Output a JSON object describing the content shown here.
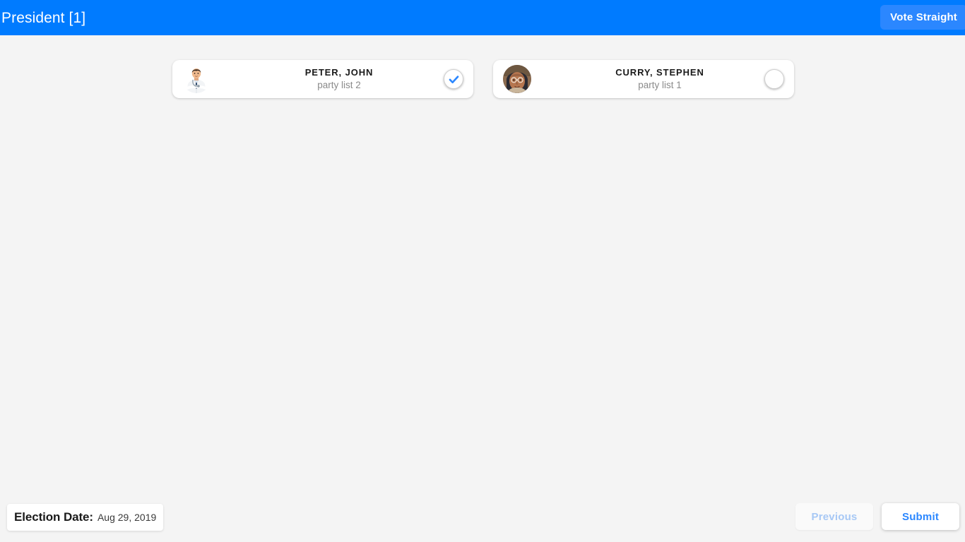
{
  "header": {
    "title": "President [1]",
    "vote_straight_label": "Vote Straight",
    "background_color": "#007bff",
    "button_color": "#2b87ff"
  },
  "ballot": {
    "candidates": [
      {
        "name": "PETER, JOHN",
        "party": "party list 2",
        "selected": true,
        "avatar_icon": "doctor-avatar-icon"
      },
      {
        "name": "CURRY, STEPHEN",
        "party": "party list 1",
        "selected": false,
        "avatar_icon": "person-photo-avatar-icon"
      }
    ]
  },
  "footer": {
    "election_date_label": "Election Date:",
    "election_date_value": "Aug 29, 2019",
    "previous_label": "Previous",
    "submit_label": "Submit",
    "previous_disabled": true,
    "accent_color": "#2b87ff",
    "disabled_color": "#a7c8f5"
  }
}
